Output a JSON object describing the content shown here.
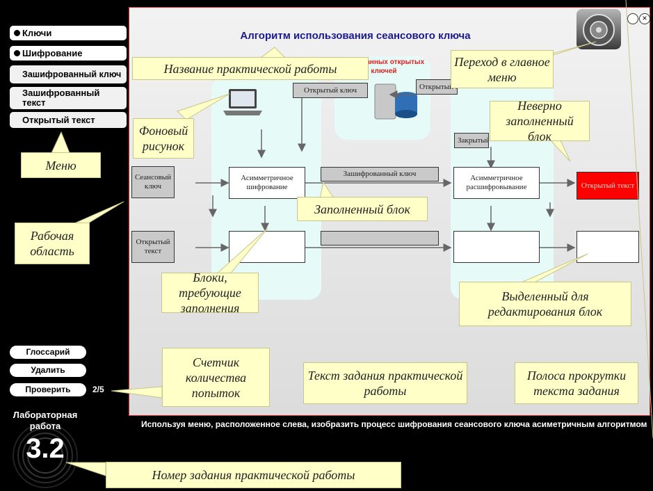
{
  "menu": {
    "items": [
      {
        "label": "Ключи"
      },
      {
        "label": "Шифрование"
      },
      {
        "label": "Зашифрованный ключ"
      },
      {
        "label": "Зашифрованный текст"
      },
      {
        "label": "Открытый текст"
      }
    ]
  },
  "actions": {
    "glossary": "Глоссарий",
    "delete": "Удалить",
    "check": "Проверить",
    "attempts": "2/5"
  },
  "lab": {
    "title": "Лабораторная работа",
    "number": "3.2"
  },
  "workspace": {
    "title": "Алгоритм использования сеансового ключа",
    "db_label": "База данных открытых ключей",
    "blocks": {
      "open_key_left": "Открытый ключ",
      "open_key_right": "Открытый ключ",
      "closed_key": "Закрытый ключ",
      "session_key": "Сеансовый ключ",
      "asym_enc": "Асимметричное шифрование",
      "enc_key": "Зашифрованный ключ",
      "asym_dec": "Асимметричное расшифровывание",
      "wrong_block": "Открытый текст",
      "plain_text_src": "Открытый текст"
    }
  },
  "task_text": "Используя меню, расположенное слева, изобразить процесс шифрования сеансового ключа асиметричным алгоритмом",
  "callouts": {
    "practice_name": "Название практической работы",
    "main_menu": "Переход в главное меню",
    "wrong_block": "Неверно заполненный блок",
    "background": "Фоновый рисунок",
    "menu": "Меню",
    "filled_block": "Заполненный блок",
    "work_area": "Рабочая область",
    "blocks_to_fill": "Блоки, требующие заполнения",
    "selected_block": "Выделенный для редактирования блок",
    "attempts_counter": "Счетчик количества попыток",
    "task_text": "Текст задания практической работы",
    "scrollbar": "Полоса прокрутки текста задания",
    "task_number": "Номер задания практической работы"
  },
  "colors": {
    "accent_red": "#ff0000",
    "callout_bg": "#ffffc8",
    "zone_bg": "#e6fbf7",
    "title_blue": "#1a1a8c"
  }
}
